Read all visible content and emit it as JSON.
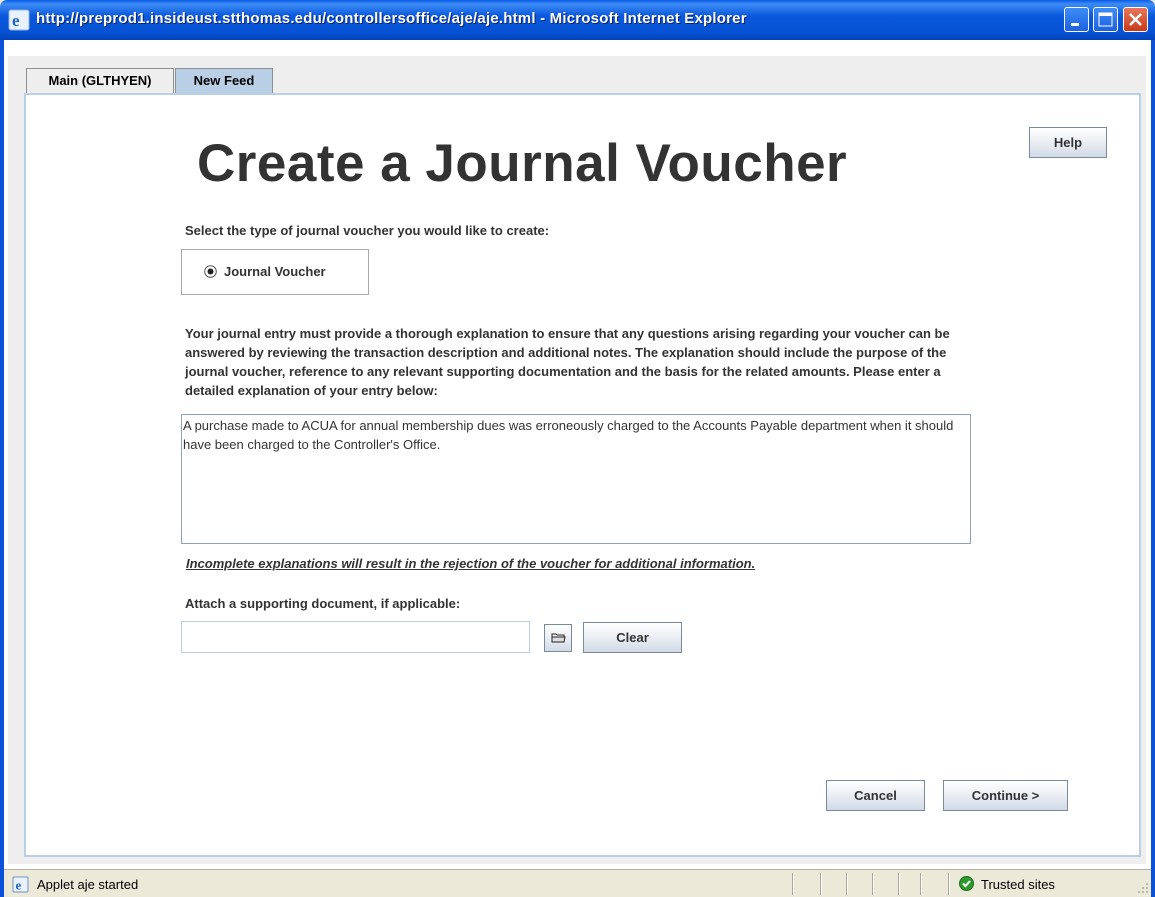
{
  "window": {
    "title": "http://preprod1.insideust.stthomas.edu/controllersoffice/aje/aje.html - Microsoft Internet Explorer",
    "title_bar_color": "#0a58dc"
  },
  "tabs": [
    {
      "label": "Main (GLTHYEN)",
      "selected": false
    },
    {
      "label": "New Feed",
      "selected": true
    }
  ],
  "panel": {
    "title": "Create a Journal Voucher",
    "help_label": "Help",
    "select_type_label": "Select the type of journal voucher you would like to create:",
    "voucher_type": {
      "label": "Journal Voucher",
      "selected": true
    },
    "instructions": "Your journal entry must provide a thorough explanation to ensure that any questions arising regarding your voucher can be answered by reviewing the transaction description and additional notes. The explanation should include the purpose of the journal voucher, reference to any relevant supporting documentation and the basis for the related amounts. Please enter a detailed explanation of your entry below:",
    "explanation_value": "A purchase made to ACUA for annual membership dues was erroneously charged to the Accounts Payable department when it should have been charged to the Controller's Office.",
    "warning": "Incomplete explanations will result in the rejection of the voucher for additional information.",
    "attach_label": "Attach a supporting document, if applicable:",
    "attach_value": "",
    "clear_label": "Clear",
    "cancel_label": "Cancel",
    "continue_label": "Continue >",
    "tab_highlight_color": "#b8cfe5"
  },
  "statusbar": {
    "status_text": "Applet aje started",
    "zone_text": "Trusted sites",
    "zone_icon": "check-circle-icon"
  }
}
